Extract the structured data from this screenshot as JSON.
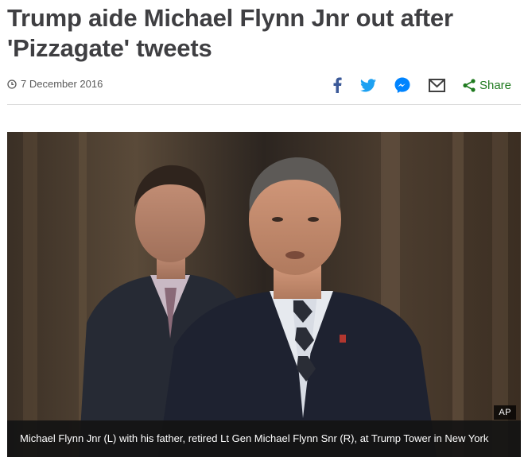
{
  "article": {
    "headline": "Trump aide Michael Flynn Jnr out after 'Pizzagate' tweets",
    "date": "7 December 2016"
  },
  "share_bar": {
    "icons": [
      "facebook-icon",
      "twitter-icon",
      "messenger-icon",
      "email-icon",
      "share-icon"
    ],
    "share_label": "Share",
    "colors": {
      "facebook": "#3b5998",
      "twitter": "#1da1f2",
      "messenger": "#0084ff",
      "email": "#404040",
      "share": "#1f7a1f"
    }
  },
  "image": {
    "credit": "AP",
    "caption": "Michael Flynn Jnr (L) with his father, retired Lt Gen Michael Flynn Snr (R), at Trump Tower in New York"
  }
}
